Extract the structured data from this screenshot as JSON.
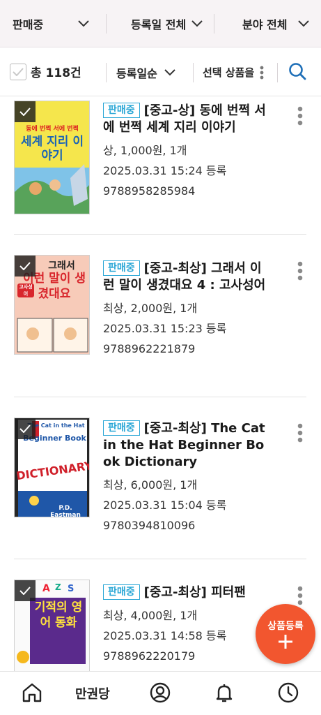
{
  "filters": {
    "status": "판매중",
    "date": "등록일 전체",
    "category": "분야 전체"
  },
  "toolbar": {
    "total": "총 118건",
    "sort": "등록일순",
    "bulk_action": "선택 상품을"
  },
  "items": [
    {
      "status": "판매중",
      "title": "[중고-상] 동에 번쩍 서에 번쩍 세계 지리 이야기",
      "condition_price": "상, 1,000원, 1개",
      "registered": "2025.03.31 15:24 등록",
      "isbn": "9788958285984",
      "cover_text_top": "동에 번쩍 서에 번쩍",
      "cover_text_main": "세계 지리 이야기"
    },
    {
      "status": "판매중",
      "title": "[중고-최상] 그래서 이런 말이 생겼대요 4 : 고사성어",
      "condition_price": "최상, 2,000원, 1개",
      "registered": "2025.03.31 15:23 등록",
      "isbn": "9788962221879",
      "cover_text_top": "그래서",
      "cover_text_main": "이런 말이 생겼대요",
      "cover_text_side": "고사성어"
    },
    {
      "status": "판매중",
      "title": "[중고-최상] The Cat in the Hat Beginner Book Dictionary",
      "condition_price": "최상, 6,000원, 1개",
      "registered": "2025.03.31 15:04 등록",
      "isbn": "9780394810096",
      "cover_text_top": "The Cat in the Hat",
      "cover_text_mid": "Beginner Book",
      "cover_text_main": "DICTIONARY",
      "cover_text_bottom": "P.D. Eastman"
    },
    {
      "status": "판매중",
      "title": "[중고-최상] 피터팬",
      "condition_price": "최상, 4,000원, 1개",
      "registered": "2025.03.31 14:58 등록",
      "isbn": "9788962220179",
      "cover_text_main": "기적의 영어 동화"
    }
  ],
  "fab": {
    "label": "상품등록"
  },
  "nav": {
    "brand": "만권당"
  },
  "colors": {
    "accent": "#2aa7d6",
    "fab": "#f2562f",
    "search_icon": "#1e6fb8"
  },
  "icons": [
    "chevron-down-icon",
    "checkbox-icon",
    "more-vertical-icon",
    "search-icon",
    "check-icon",
    "plus-icon",
    "home-icon",
    "user-icon",
    "bell-icon",
    "clock-icon"
  ]
}
